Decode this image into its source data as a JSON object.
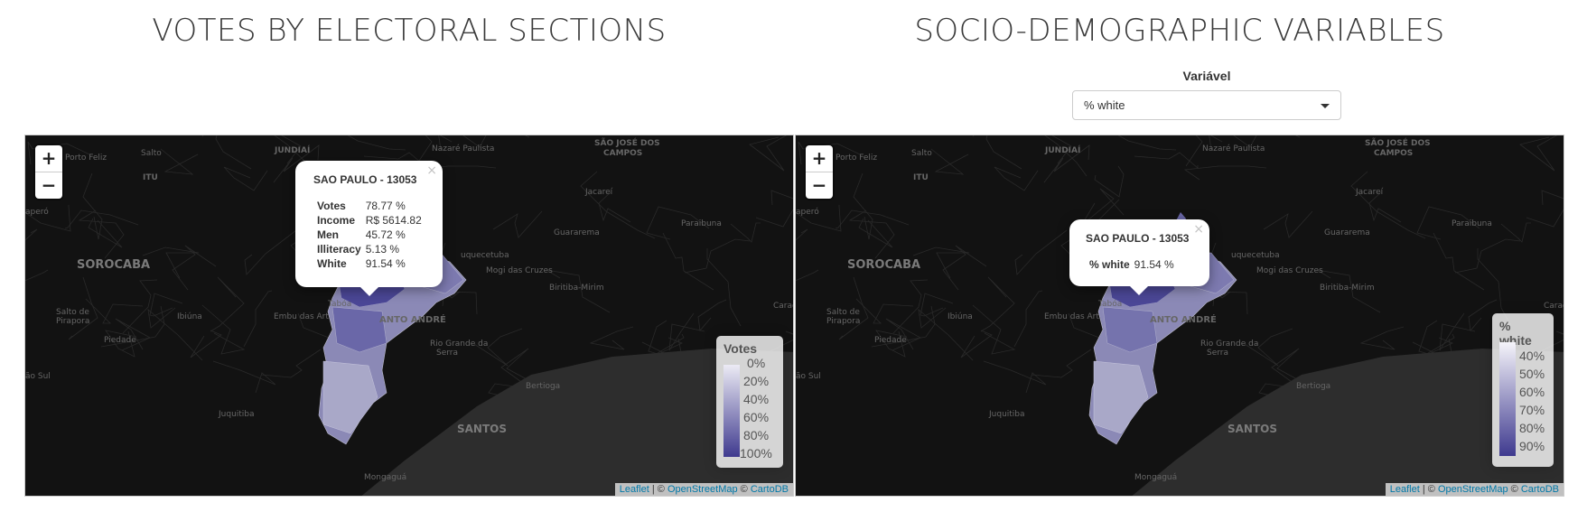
{
  "left": {
    "title": "VOTES BY ELECTORAL SECTIONS",
    "zoom_in": "+",
    "zoom_out": "−",
    "popup": {
      "close": "×",
      "title": "SAO PAULO - 13053",
      "rows": [
        {
          "k": "Votes",
          "v": "78.77 %"
        },
        {
          "k": "Income",
          "v": "R$ 5614.82"
        },
        {
          "k": "Men",
          "v": "45.72 %"
        },
        {
          "k": "Illiteracy",
          "v": "5.13 %"
        },
        {
          "k": "White",
          "v": "91.54 %"
        }
      ]
    },
    "legend": {
      "title": "Votes",
      "labels": [
        "0%",
        "20%",
        "40%",
        "60%",
        "80%",
        "100%"
      ],
      "color_low": "#ecebf5",
      "color_high": "#3f3a8f"
    }
  },
  "right": {
    "title": "SOCIO-DEMOGRAPHIC VARIABLES",
    "select_label": "Variável",
    "select_value": "% white",
    "zoom_in": "+",
    "zoom_out": "−",
    "popup": {
      "close": "×",
      "title": "SAO PAULO - 13053",
      "rows": [
        {
          "k": "% white",
          "v": "91.54 %"
        }
      ]
    },
    "legend": {
      "title": "% white",
      "labels": [
        "40%",
        "50%",
        "60%",
        "70%",
        "80%",
        "90%"
      ],
      "color_low": "#f5f4fa",
      "color_high": "#3f3a8f"
    }
  },
  "attribution": {
    "leaflet": "Leaflet",
    "sep1": " | © ",
    "osm": "OpenStreetMap",
    "sep2": " © ",
    "carto": "CartoDB"
  },
  "map_labels": [
    "Porto Feliz",
    "Salto",
    "JUNDIAÍ",
    "Nazaré Paulista",
    "SÃO JOSÉ DOS",
    "CAMPOS",
    "ITU",
    "Jacareí",
    "Guararema",
    "Paraibuna",
    "SOROCABA",
    "Mogi das Cruzes",
    "Biritiba-Mirim",
    "Salto de",
    "Pirapora",
    "Ibiúna",
    "Embu das Art",
    "ANTO ANDRÉ",
    "Piedade",
    "Rio Grande da",
    "Serra",
    "Bertioga",
    "Juquitiba",
    "SANTOS",
    "Mongaguá",
    "Caraguat",
    "aperó",
    "ão Sul",
    "Tabóa",
    "uquecetuba"
  ],
  "colors": {
    "map_bg": "#121212",
    "land_texture": "#2a2a2a",
    "sea": "#2d2d2d",
    "choropleth_dark": "#4b4796",
    "choropleth_light": "#a9a8c8"
  }
}
